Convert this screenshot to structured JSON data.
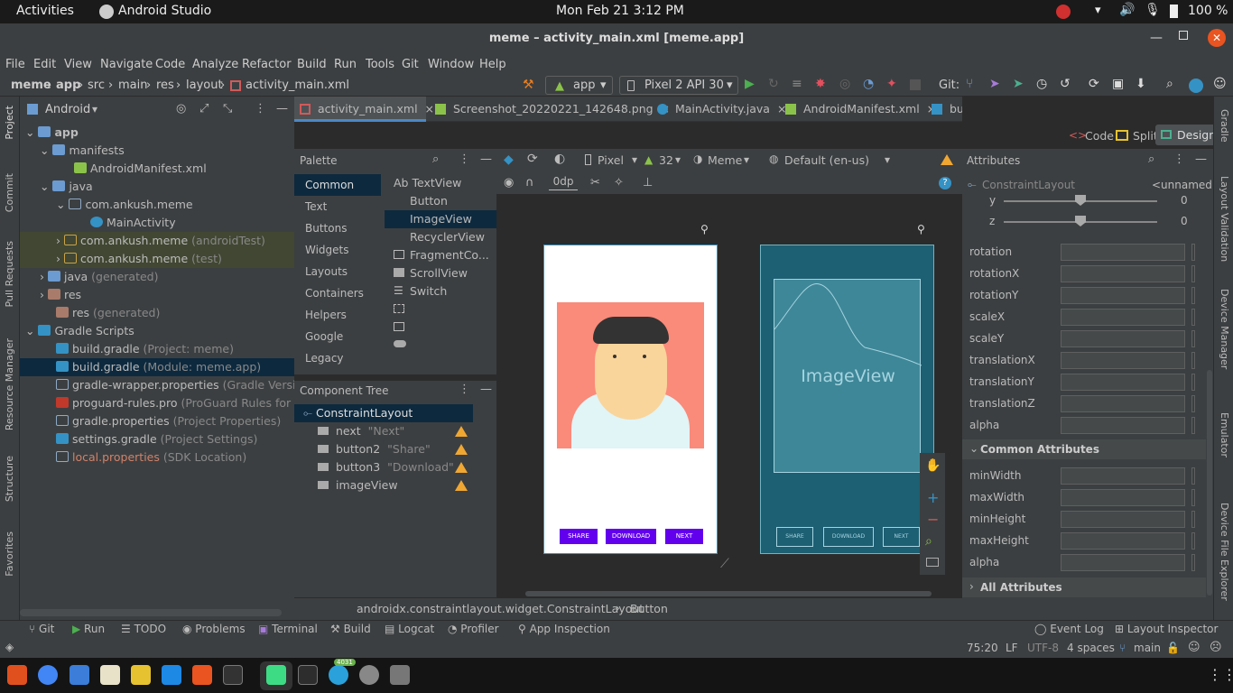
{
  "system_bar": {
    "activities": "Activities",
    "app_name": "Android Studio",
    "datetime": "Mon Feb 21  3:12 PM",
    "battery": "100 %"
  },
  "window": {
    "title": "meme – activity_main.xml [meme.app]"
  },
  "menu": [
    "File",
    "Edit",
    "View",
    "Navigate",
    "Code",
    "Analyze",
    "Refactor",
    "Build",
    "Run",
    "Tools",
    "Git",
    "Window",
    "Help"
  ],
  "breadcrumb": [
    "meme",
    "app",
    "src",
    "main",
    "res",
    "layout",
    "activity_main.xml"
  ],
  "toolbar": {
    "run_config": "app",
    "device": "Pixel 2 API 30",
    "git_label": "Git:"
  },
  "left_strip": [
    "Project",
    "Commit",
    "Pull Requests",
    "Resource Manager",
    "Structure",
    "Favorites"
  ],
  "right_strip": [
    "Gradle",
    "Layout Validation",
    "Device Manager",
    "Emulator",
    "Device File Explorer"
  ],
  "project": {
    "view_selector": "Android",
    "tree": [
      {
        "label": "app",
        "suffix": ""
      },
      {
        "label": "manifests",
        "suffix": ""
      },
      {
        "label": "AndroidManifest.xml",
        "suffix": ""
      },
      {
        "label": "java",
        "suffix": ""
      },
      {
        "label": "com.ankush.meme",
        "suffix": ""
      },
      {
        "label": "MainActivity",
        "suffix": ""
      },
      {
        "label": "com.ankush.meme",
        "suffix": " (androidTest)"
      },
      {
        "label": "com.ankush.meme",
        "suffix": " (test)"
      },
      {
        "label": "java",
        "suffix": " (generated)"
      },
      {
        "label": "res",
        "suffix": ""
      },
      {
        "label": "res",
        "suffix": " (generated)"
      },
      {
        "label": "Gradle Scripts",
        "suffix": ""
      },
      {
        "label": "build.gradle",
        "suffix": " (Project: meme)"
      },
      {
        "label": "build.gradle",
        "suffix": " (Module: meme.app)"
      },
      {
        "label": "gradle-wrapper.properties",
        "suffix": " (Gradle Version)"
      },
      {
        "label": "proguard-rules.pro",
        "suffix": " (ProGuard Rules for mem"
      },
      {
        "label": "gradle.properties",
        "suffix": " (Project Properties)"
      },
      {
        "label": "settings.gradle",
        "suffix": " (Project Settings)"
      },
      {
        "label": "local.properties",
        "suffix": " (SDK Location)"
      }
    ]
  },
  "tabs": [
    {
      "label": "activity_main.xml"
    },
    {
      "label": "Screenshot_20220221_142648.png"
    },
    {
      "label": "MainActivity.java"
    },
    {
      "label": "AndroidManifest.xml"
    },
    {
      "label": "build.gradle (:app)"
    }
  ],
  "view_modes": {
    "code": "Code",
    "split": "Split",
    "design": "Design"
  },
  "palette": {
    "title": "Palette",
    "categories": [
      "Common",
      "Text",
      "Buttons",
      "Widgets",
      "Layouts",
      "Containers",
      "Helpers",
      "Google",
      "Legacy"
    ],
    "items": [
      "Ab TextView",
      "Button",
      "ImageView",
      "RecyclerView",
      "FragmentCo...",
      "ScrollView",
      "Switch"
    ]
  },
  "design_toolbar": {
    "device": "Pixel",
    "api": "32",
    "theme": "Meme",
    "locale": "Default (en-us)",
    "margin": "0dp"
  },
  "component_tree": {
    "title": "Component Tree",
    "root": "ConstraintLayout",
    "children": [
      {
        "id": "next",
        "text": "\"Next\""
      },
      {
        "id": "button2",
        "text": "\"Share\""
      },
      {
        "id": "button3",
        "text": "\"Download\""
      },
      {
        "id": "imageView",
        "text": ""
      }
    ]
  },
  "preview": {
    "buttons": [
      "SHARE",
      "DOWNLOAD",
      "NEXT"
    ],
    "blueprint_label": "ImageView"
  },
  "attributes": {
    "title": "Attributes",
    "component": "ConstraintLayout",
    "component_id": "<unnamed>",
    "slider_rows": [
      {
        "label": "y",
        "value": "0"
      },
      {
        "label": "z",
        "value": "0"
      }
    ],
    "transform_rows": [
      "rotation",
      "rotationX",
      "rotationY",
      "scaleX",
      "scaleY",
      "translationX",
      "translationY",
      "translationZ",
      "alpha"
    ],
    "common_header": "Common Attributes",
    "common_rows": [
      "minWidth",
      "maxWidth",
      "minHeight",
      "maxHeight",
      "alpha"
    ],
    "all_header": "All Attributes"
  },
  "editor_breadcrumb": [
    "androidx.constraintlayout.widget.ConstraintLayout",
    "Button"
  ],
  "bottom_tools": [
    "Git",
    "Run",
    "TODO",
    "Problems",
    "Terminal",
    "Build",
    "Logcat",
    "Profiler",
    "App Inspection"
  ],
  "bottom_right_tools": [
    "Event Log",
    "Layout Inspector"
  ],
  "status": {
    "position": "75:20",
    "line_sep": "LF",
    "encoding": "UTF-8",
    "indent": "4 spaces",
    "branch": "main"
  },
  "dock_badge": "4031"
}
